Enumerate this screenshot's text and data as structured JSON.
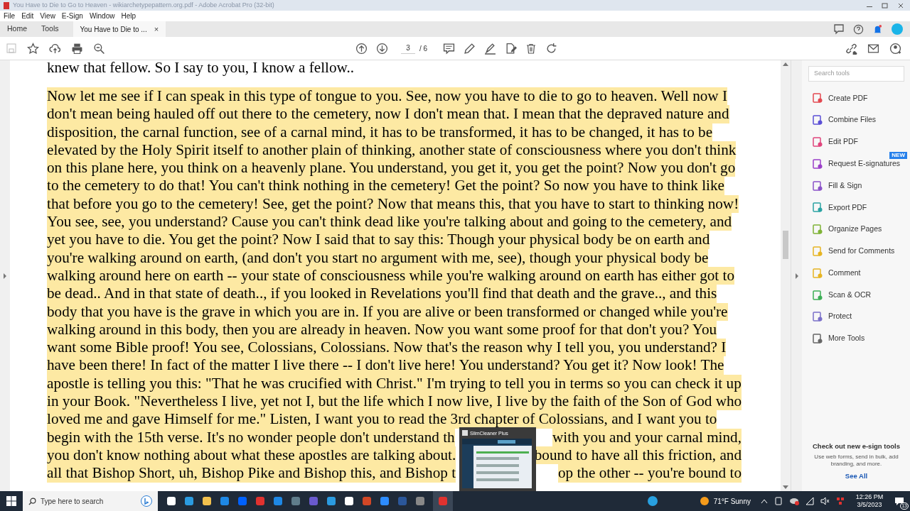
{
  "window": {
    "title": "You Have to Die to Go to Heaven - wikiarchetypepattern.org.pdf - Adobe Acrobat Pro (32-bit)"
  },
  "menu": [
    "File",
    "Edit",
    "View",
    "E-Sign",
    "Window",
    "Help"
  ],
  "tabs": [
    {
      "label": "Home",
      "selected": false
    },
    {
      "label": "Tools",
      "selected": false
    },
    {
      "label": "You Have to Die to ...",
      "selected": true,
      "close": "×"
    }
  ],
  "page_nav": {
    "current": "3",
    "total": "/ 6"
  },
  "document": {
    "lines": [
      {
        "highlighted": false,
        "text": "knew that fellow. So I say to you, I know a fellow.."
      },
      {
        "highlighted": true,
        "text": "Now let me see if I can speak in this type of tongue to you. See, now you have to die to go to heaven. Well now I"
      },
      {
        "highlighted": true,
        "text": "don't mean being hauled off out there to the cemetery, now I don't mean that. I mean that the depraved nature and"
      },
      {
        "highlighted": true,
        "text": "disposition, the carnal function, see of a carnal mind, it has to be transformed, it has to be changed, it has to be"
      },
      {
        "highlighted": true,
        "text": "elevated by the Holy Spirit itself to another plain of thinking, another state of consciousness where you don't think"
      },
      {
        "highlighted": true,
        "text": "on this plane here, you think on a heavenly plane. You understand, you get it, you get the point? Now you don't go"
      },
      {
        "highlighted": true,
        "text": "to the cemetery to do that! You can't think nothing in the cemetery! Get the point? So now you have to think like"
      },
      {
        "highlighted": true,
        "text": "that before you go to the cemetery! See, get the point? Now that means this, that you have to start to thinking now!"
      },
      {
        "highlighted": true,
        "text": "You see, see, you understand? Cause you can't think dead like you're talking about and going to the cemetery, and"
      },
      {
        "highlighted": true,
        "text": "yet you have to die. You get the point? Now I said that to say this: Though your physical body be on earth and"
      },
      {
        "highlighted": true,
        "text": "you're walking around on earth, (and don't you start no argument with me, see), though your physical body be"
      },
      {
        "highlighted": true,
        "text": "walking around here on earth -- your state of consciousness while you're walking around on earth has either got to"
      },
      {
        "highlighted": true,
        "text": "be dead.. And in that state of death.., if you looked in Revelations you'll find that death and the grave.., and this"
      },
      {
        "highlighted": true,
        "text": "body that you have is the grave in which you are in. If you are alive or been transformed or changed while you're"
      },
      {
        "highlighted": true,
        "text": "walking around in this body, then you are already in heaven. Now you want some proof for that don't you? You"
      },
      {
        "highlighted": true,
        "text": "want some Bible proof! You see, Colossians, Colossians. Now that's the reason why I tell you, you understand? I"
      },
      {
        "highlighted": true,
        "text": "have been there! In fact of the matter I live there -- I don't live here! You understand? You get it? Now look! The"
      },
      {
        "highlighted": true,
        "text": "apostle is telling you this: \"That he was crucified with Christ.\" I'm trying to tell you in terms so you can check it up"
      },
      {
        "highlighted": true,
        "text": "in your Book. \"Nevertheless I live, yet not I, but the life which I now live, I live by the faith of the Son of God who"
      },
      {
        "highlighted": true,
        "text": "loved me and gave Himself for me.\" Listen, I want you to read the 3rd chapter of Colossians, and I want you to"
      },
      {
        "highlighted": true,
        "text": "begin with the 15th verse. It's no wonder people don't understand th",
        "text_after": "with you and your carnal mind,"
      },
      {
        "highlighted": true,
        "text": "you don't know nothing about what these apostles are talking about.",
        "text_after": "bound to have all this friction, and"
      },
      {
        "highlighted": true,
        "text": "all that Bishop Short, uh, Bishop Pike and Bishop this, and Bishop t",
        "text_after": "op the other -- you're bound to"
      }
    ]
  },
  "tools_panel": {
    "search": {
      "placeholder": "Search tools"
    },
    "items": [
      {
        "label": "Create PDF"
      },
      {
        "label": "Combine Files"
      },
      {
        "label": "Edit PDF"
      },
      {
        "label": "Request E-signatures",
        "badge": "NEW"
      },
      {
        "label": "Fill & Sign"
      },
      {
        "label": "Export PDF"
      },
      {
        "label": "Organize Pages"
      },
      {
        "label": "Send for Comments"
      },
      {
        "label": "Comment"
      },
      {
        "label": "Scan & OCR"
      },
      {
        "label": "Protect"
      },
      {
        "label": "More Tools"
      }
    ],
    "promo": {
      "title": "Check out new e-sign tools",
      "body": "Use web forms, send in bulk, add branding, and more.",
      "link": "See All"
    }
  },
  "thumbnail_popup": {
    "title": "SlimCleaner Plus"
  },
  "taskbar": {
    "search": {
      "placeholder": "Type here to search"
    },
    "weather": "71°F Sunny",
    "time": "12:26 PM",
    "date": "3/5/2023",
    "notifications": "13"
  }
}
